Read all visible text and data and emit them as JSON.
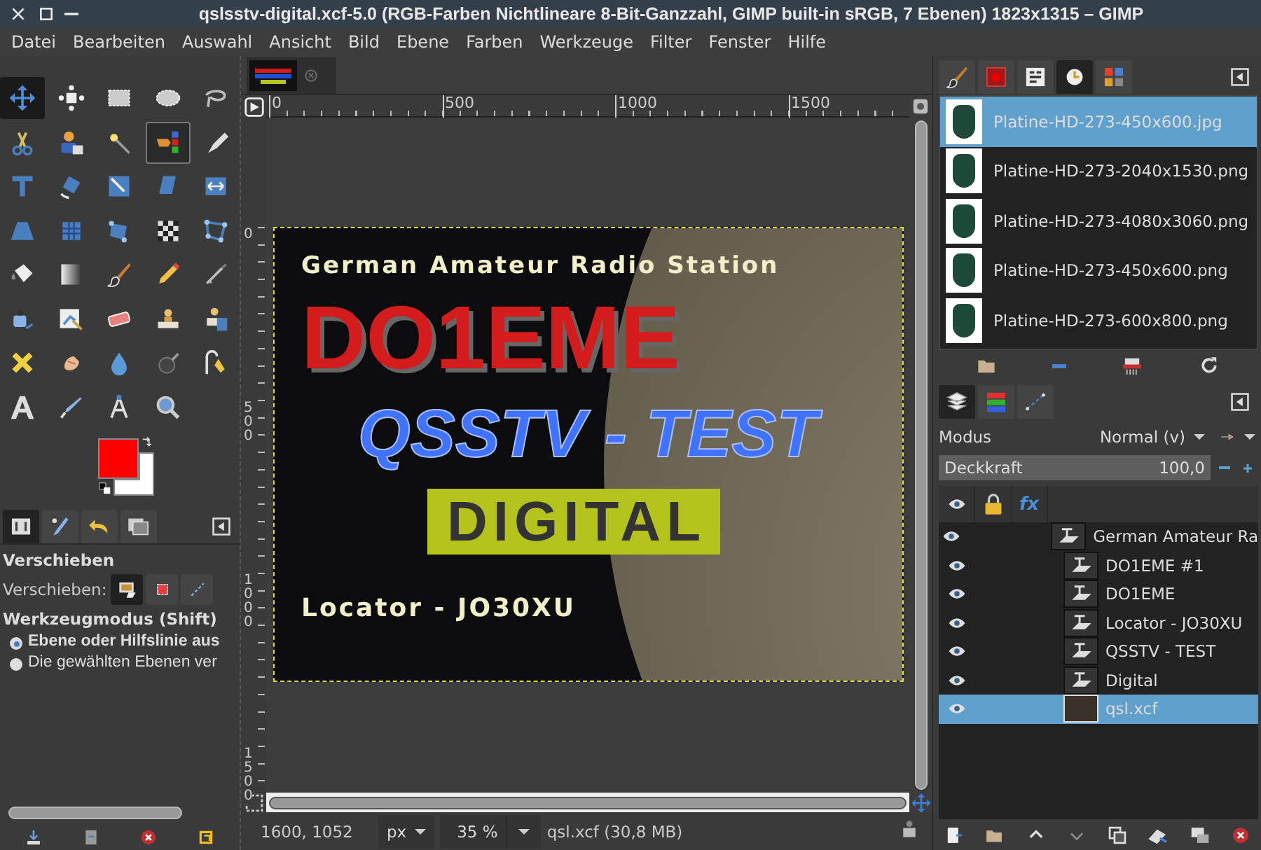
{
  "window": {
    "title": "qslsstv-digital.xcf-5.0 (RGB-Farben Nichtlineare 8-Bit-Ganzzahl, GIMP built-in sRGB, 7 Ebenen) 1823x1315 – GIMP"
  },
  "menu": [
    "Datei",
    "Bearbeiten",
    "Auswahl",
    "Ansicht",
    "Bild",
    "Ebene",
    "Farben",
    "Werkzeuge",
    "Filter",
    "Fenster",
    "Hilfe"
  ],
  "toolbox": {
    "tools": [
      {
        "kind": "move",
        "selected": true,
        "hovered": false
      },
      {
        "kind": "align",
        "selected": false,
        "hovered": false
      },
      {
        "kind": "rect-select",
        "selected": false,
        "hovered": false
      },
      {
        "kind": "ellipse-select",
        "selected": false,
        "hovered": false
      },
      {
        "kind": "lasso",
        "selected": false,
        "hovered": false
      },
      {
        "kind": "scissors",
        "selected": false,
        "hovered": false
      },
      {
        "kind": "foreground-select",
        "selected": false,
        "hovered": false
      },
      {
        "kind": "fuzzy-select",
        "selected": false,
        "hovered": false
      },
      {
        "kind": "color-select",
        "selected": false,
        "hovered": true
      },
      {
        "kind": "paths",
        "selected": false,
        "hovered": false
      },
      {
        "kind": "unified-transform",
        "selected": false,
        "hovered": false
      },
      {
        "kind": "rotate",
        "selected": false,
        "hovered": false
      },
      {
        "kind": "scale",
        "selected": false,
        "hovered": false
      },
      {
        "kind": "shear",
        "selected": false,
        "hovered": false
      },
      {
        "kind": "flip",
        "selected": false,
        "hovered": false
      },
      {
        "kind": "perspective",
        "selected": false,
        "hovered": false
      },
      {
        "kind": "cage",
        "selected": false,
        "hovered": false
      },
      {
        "kind": "handle-transform",
        "selected": false,
        "hovered": false
      },
      {
        "kind": "warp",
        "selected": false,
        "hovered": false
      },
      {
        "kind": "n-point",
        "selected": false,
        "hovered": false
      },
      {
        "kind": "bucket",
        "selected": false,
        "hovered": false
      },
      {
        "kind": "gradient",
        "selected": false,
        "hovered": false
      },
      {
        "kind": "paintbrush",
        "selected": false,
        "hovered": false
      },
      {
        "kind": "pencil",
        "selected": false,
        "hovered": false
      },
      {
        "kind": "airbrush",
        "selected": false,
        "hovered": false
      },
      {
        "kind": "ink",
        "selected": false,
        "hovered": false
      },
      {
        "kind": "mypaint",
        "selected": false,
        "hovered": false
      },
      {
        "kind": "eraser",
        "selected": false,
        "hovered": false
      },
      {
        "kind": "clone",
        "selected": false,
        "hovered": false
      },
      {
        "kind": "heal",
        "selected": false,
        "hovered": false
      },
      {
        "kind": "perspective-clone",
        "selected": false,
        "hovered": false
      },
      {
        "kind": "smudge",
        "selected": false,
        "hovered": false
      },
      {
        "kind": "blur",
        "selected": false,
        "hovered": false
      },
      {
        "kind": "dodge",
        "selected": false,
        "hovered": false
      },
      {
        "kind": "warp-pen",
        "selected": false,
        "hovered": false
      },
      {
        "kind": "text",
        "selected": false,
        "hovered": false
      },
      {
        "kind": "color-picker",
        "selected": false,
        "hovered": false
      },
      {
        "kind": "measure",
        "selected": false,
        "hovered": false
      },
      {
        "kind": "zoom",
        "selected": false,
        "hovered": false
      }
    ],
    "swatches": [
      {
        "kind": "foreground",
        "color": "#ff0000"
      },
      {
        "kind": "background",
        "color": "#ffffff"
      }
    ],
    "tabs": [
      {
        "kind": "tool-options",
        "selected": true
      },
      {
        "kind": "device-status",
        "selected": false
      },
      {
        "kind": "undo-history",
        "selected": false
      },
      {
        "kind": "images",
        "selected": false
      }
    ]
  },
  "tool_options": {
    "title": "Verschieben",
    "move_label": "Verschieben:",
    "move_modes": [
      {
        "kind": "layer",
        "selected": true
      },
      {
        "kind": "selection",
        "selected": false
      },
      {
        "kind": "path",
        "selected": false
      }
    ],
    "mode_title": "Werkzeugmodus (Shift)",
    "options": [
      {
        "label": "Ebene oder Hilfslinie aus",
        "selected": true
      },
      {
        "label": "Die gewählten Ebenen ver",
        "selected": false
      }
    ]
  },
  "image_window": {
    "rulers": {
      "horizontal": [
        "0",
        "500",
        "1000",
        "1500"
      ],
      "vertical": [
        "0",
        "500",
        "1000",
        "1500"
      ]
    },
    "texts": [
      {
        "kind": "heading",
        "text": "German Amateur Radio Station"
      },
      {
        "kind": "callsign",
        "text": "DO1EME"
      },
      {
        "kind": "mode",
        "text": "QSSTV - TEST"
      },
      {
        "kind": "digital",
        "text": "DIGITAL"
      },
      {
        "kind": "locator",
        "text": "Locator - JO30XU"
      }
    ]
  },
  "status_bar": {
    "coordinates": "1600, 1052",
    "unit": "px",
    "zoom": "35 %",
    "info": "qsl.xcf (30,8 MB)"
  },
  "dock": {
    "tabs": [
      {
        "kind": "brushes",
        "selected": false
      },
      {
        "kind": "patterns",
        "selected": false
      },
      {
        "kind": "fonts",
        "selected": false
      },
      {
        "kind": "history",
        "selected": true
      },
      {
        "kind": "palettes",
        "selected": false
      }
    ],
    "images": [
      {
        "name": "Platine-HD-273-450x600.jpg",
        "selected": true
      },
      {
        "name": "Platine-HD-273-2040x1530.png",
        "selected": false
      },
      {
        "name": "Platine-HD-273-4080x3060.png",
        "selected": false
      },
      {
        "name": "Platine-HD-273-450x600.png",
        "selected": false
      },
      {
        "name": "Platine-HD-273-600x800.png",
        "selected": false
      }
    ],
    "layer_tabs": [
      {
        "kind": "layers",
        "selected": true
      },
      {
        "kind": "channels",
        "selected": false
      },
      {
        "kind": "paths",
        "selected": false
      }
    ],
    "mode_label": "Modus",
    "mode_value": "Normal (v)",
    "opacity_label": "Deckkraft",
    "opacity_value": "100,0",
    "opacity": {
      "level": 1
    },
    "effects_header": "fx",
    "layers": [
      {
        "name": "German Amateur Ra",
        "kind": "text",
        "visible": true,
        "selected": false
      },
      {
        "name": "DO1EME #1",
        "kind": "text",
        "visible": true,
        "selected": false
      },
      {
        "name": "DO1EME",
        "kind": "text",
        "visible": true,
        "selected": false
      },
      {
        "name": "Locator - JO30XU",
        "kind": "text",
        "visible": true,
        "selected": false
      },
      {
        "name": "QSSTV - TEST",
        "kind": "text",
        "visible": true,
        "selected": false
      },
      {
        "name": "Digital",
        "kind": "text",
        "visible": true,
        "selected": false
      },
      {
        "name": "qsl.xcf",
        "kind": "image",
        "visible": true,
        "selected": true
      }
    ]
  }
}
